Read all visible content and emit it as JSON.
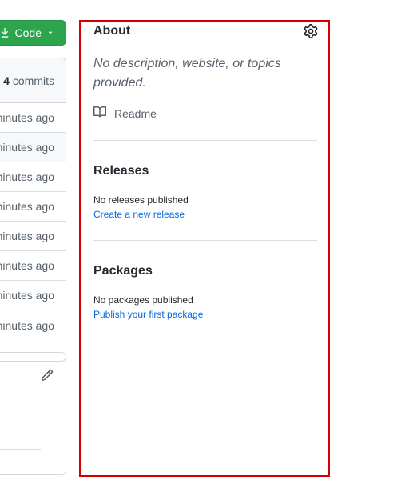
{
  "left_column": {
    "code_button_label": "Code",
    "commits_count": "4",
    "commits_label": "commits",
    "rows": [
      "minutes ago",
      "minutes ago",
      "minutes ago",
      "minutes ago",
      "minutes ago",
      "minutes ago",
      "minutes ago",
      "minutes ago"
    ]
  },
  "sidebar": {
    "about": {
      "title": "About",
      "description": "No description, website, or topics provided.",
      "readme_label": "Readme"
    },
    "releases": {
      "title": "Releases",
      "status": "No releases published",
      "link": "Create a new release"
    },
    "packages": {
      "title": "Packages",
      "status": "No packages published",
      "link": "Publish your first package"
    }
  },
  "colors": {
    "code_button_bg": "#2da44e",
    "link": "#0969da",
    "highlight_border": "#d40000"
  },
  "icons": [
    "download-icon",
    "chevron-down-icon",
    "gear-icon",
    "book-icon",
    "pencil-icon"
  ]
}
